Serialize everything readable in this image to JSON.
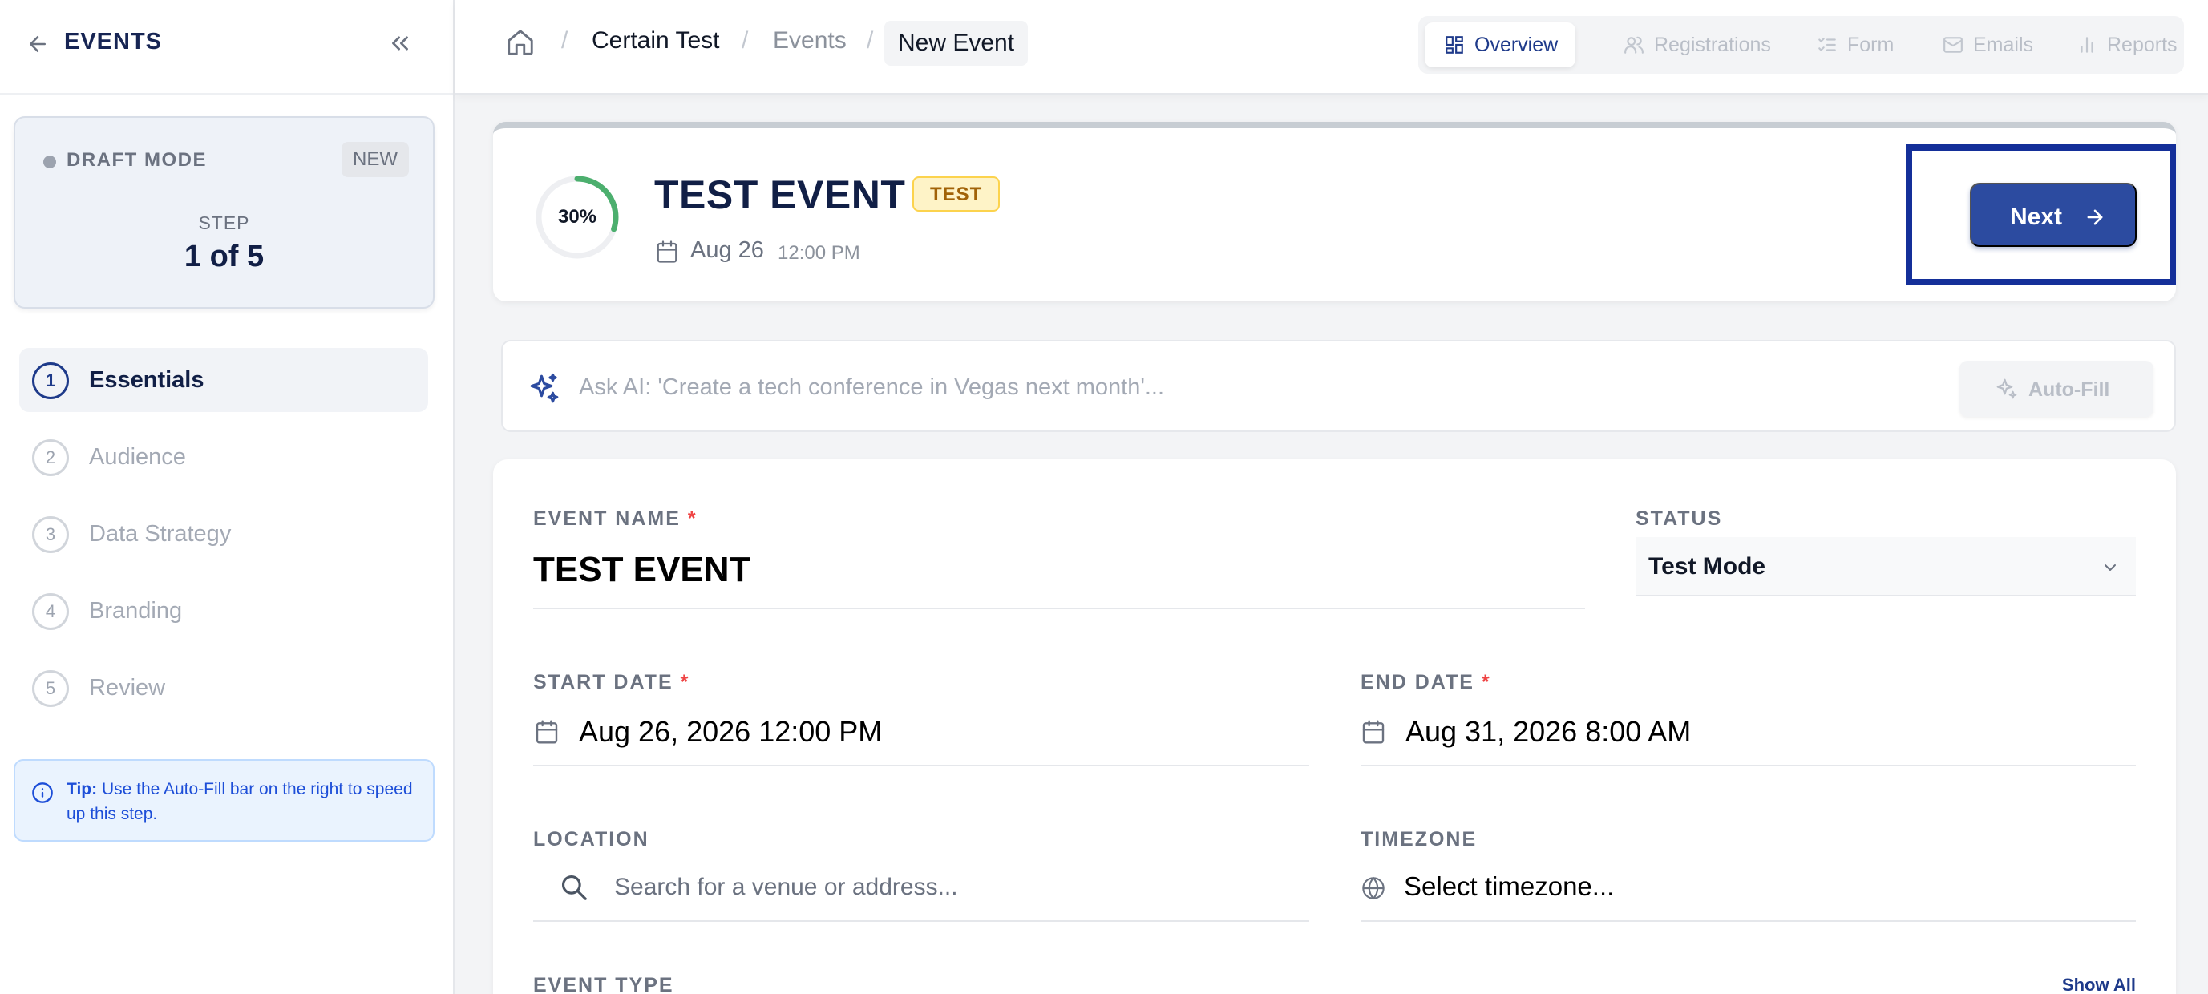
{
  "sidebar": {
    "title": "EVENTS",
    "draft": {
      "label": "DRAFT MODE",
      "badge": "NEW",
      "step_caption": "STEP",
      "step_value": "1 of 5"
    },
    "steps": [
      {
        "num": "1",
        "label": "Essentials",
        "active": true
      },
      {
        "num": "2",
        "label": "Audience",
        "active": false
      },
      {
        "num": "3",
        "label": "Data Strategy",
        "active": false
      },
      {
        "num": "4",
        "label": "Branding",
        "active": false
      },
      {
        "num": "5",
        "label": "Review",
        "active": false
      }
    ],
    "tip": {
      "label": "Tip:",
      "text": " Use the Auto-Fill bar on the right to speed up this step."
    }
  },
  "breadcrumb": {
    "items": [
      "Certain Test",
      "Events"
    ],
    "current": "New Event",
    "separator": "/"
  },
  "tabs": [
    {
      "label": "Overview",
      "icon": "grid-icon",
      "active": true
    },
    {
      "label": "Registrations",
      "icon": "users-icon",
      "active": false
    },
    {
      "label": "Form",
      "icon": "list-check-icon",
      "active": false
    },
    {
      "label": "Emails",
      "icon": "mail-icon",
      "active": false
    },
    {
      "label": "Reports",
      "icon": "bar-chart-icon",
      "active": false
    }
  ],
  "event": {
    "progress_label": "30%",
    "progress_value": 0.3,
    "title": "TEST EVENT",
    "badge": "TEST",
    "date": "Aug 26",
    "time": "12:00 PM",
    "next_label": "Next"
  },
  "ai": {
    "placeholder": "Ask AI: 'Create a tech conference in Vegas next month'...",
    "autofill_label": "Auto-Fill"
  },
  "form": {
    "event_name": {
      "label": "EVENT NAME",
      "required": "*",
      "value": "TEST EVENT"
    },
    "status": {
      "label": "STATUS",
      "value": "Test Mode"
    },
    "start_date": {
      "label": "START DATE",
      "required": "*",
      "value": "Aug 26, 2026 12:00 PM"
    },
    "end_date": {
      "label": "END DATE",
      "required": "*",
      "value": "Aug 31, 2026 8:00 AM"
    },
    "location": {
      "label": "LOCATION",
      "placeholder": "Search for a venue or address..."
    },
    "timezone": {
      "label": "TIMEZONE",
      "value": "Select timezone..."
    },
    "event_type": {
      "label": "EVENT TYPE",
      "show_all": "Show All"
    }
  },
  "colors": {
    "accent": "#2c4ba0",
    "highlight_border": "#142f99",
    "progress_arc": "#4caf6e",
    "required": "#ef4444",
    "test_badge_bg": "#fef3c7",
    "test_badge_text": "#a16207"
  }
}
